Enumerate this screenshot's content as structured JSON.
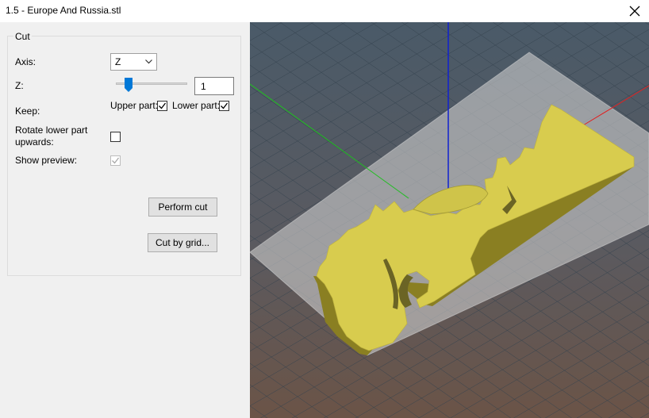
{
  "window": {
    "title": "1.5 - Europe And Russia.stl",
    "close_icon": "close-icon"
  },
  "cut": {
    "group_label": "Cut",
    "axis_label": "Axis:",
    "axis_value": "Z",
    "z_label": "Z:",
    "z_value": "1",
    "z_slider_fraction": 0.18,
    "keep_label": "Keep:",
    "upper_part_label": "Upper part:",
    "upper_part_checked": true,
    "lower_part_label": "Lower part:",
    "lower_part_checked": true,
    "rotate_label_line1": "Rotate lower part",
    "rotate_label_line2": "upwards:",
    "rotate_checked": false,
    "show_preview_label": "Show preview:",
    "show_preview_checked": true,
    "perform_cut_label": "Perform cut",
    "cut_by_grid_label": "Cut by grid..."
  },
  "colors": {
    "accent": "#0078d7",
    "model": "#d8cc4e",
    "axis_x": "#e02020",
    "axis_y": "#20c020",
    "axis_z": "#1020d0"
  }
}
